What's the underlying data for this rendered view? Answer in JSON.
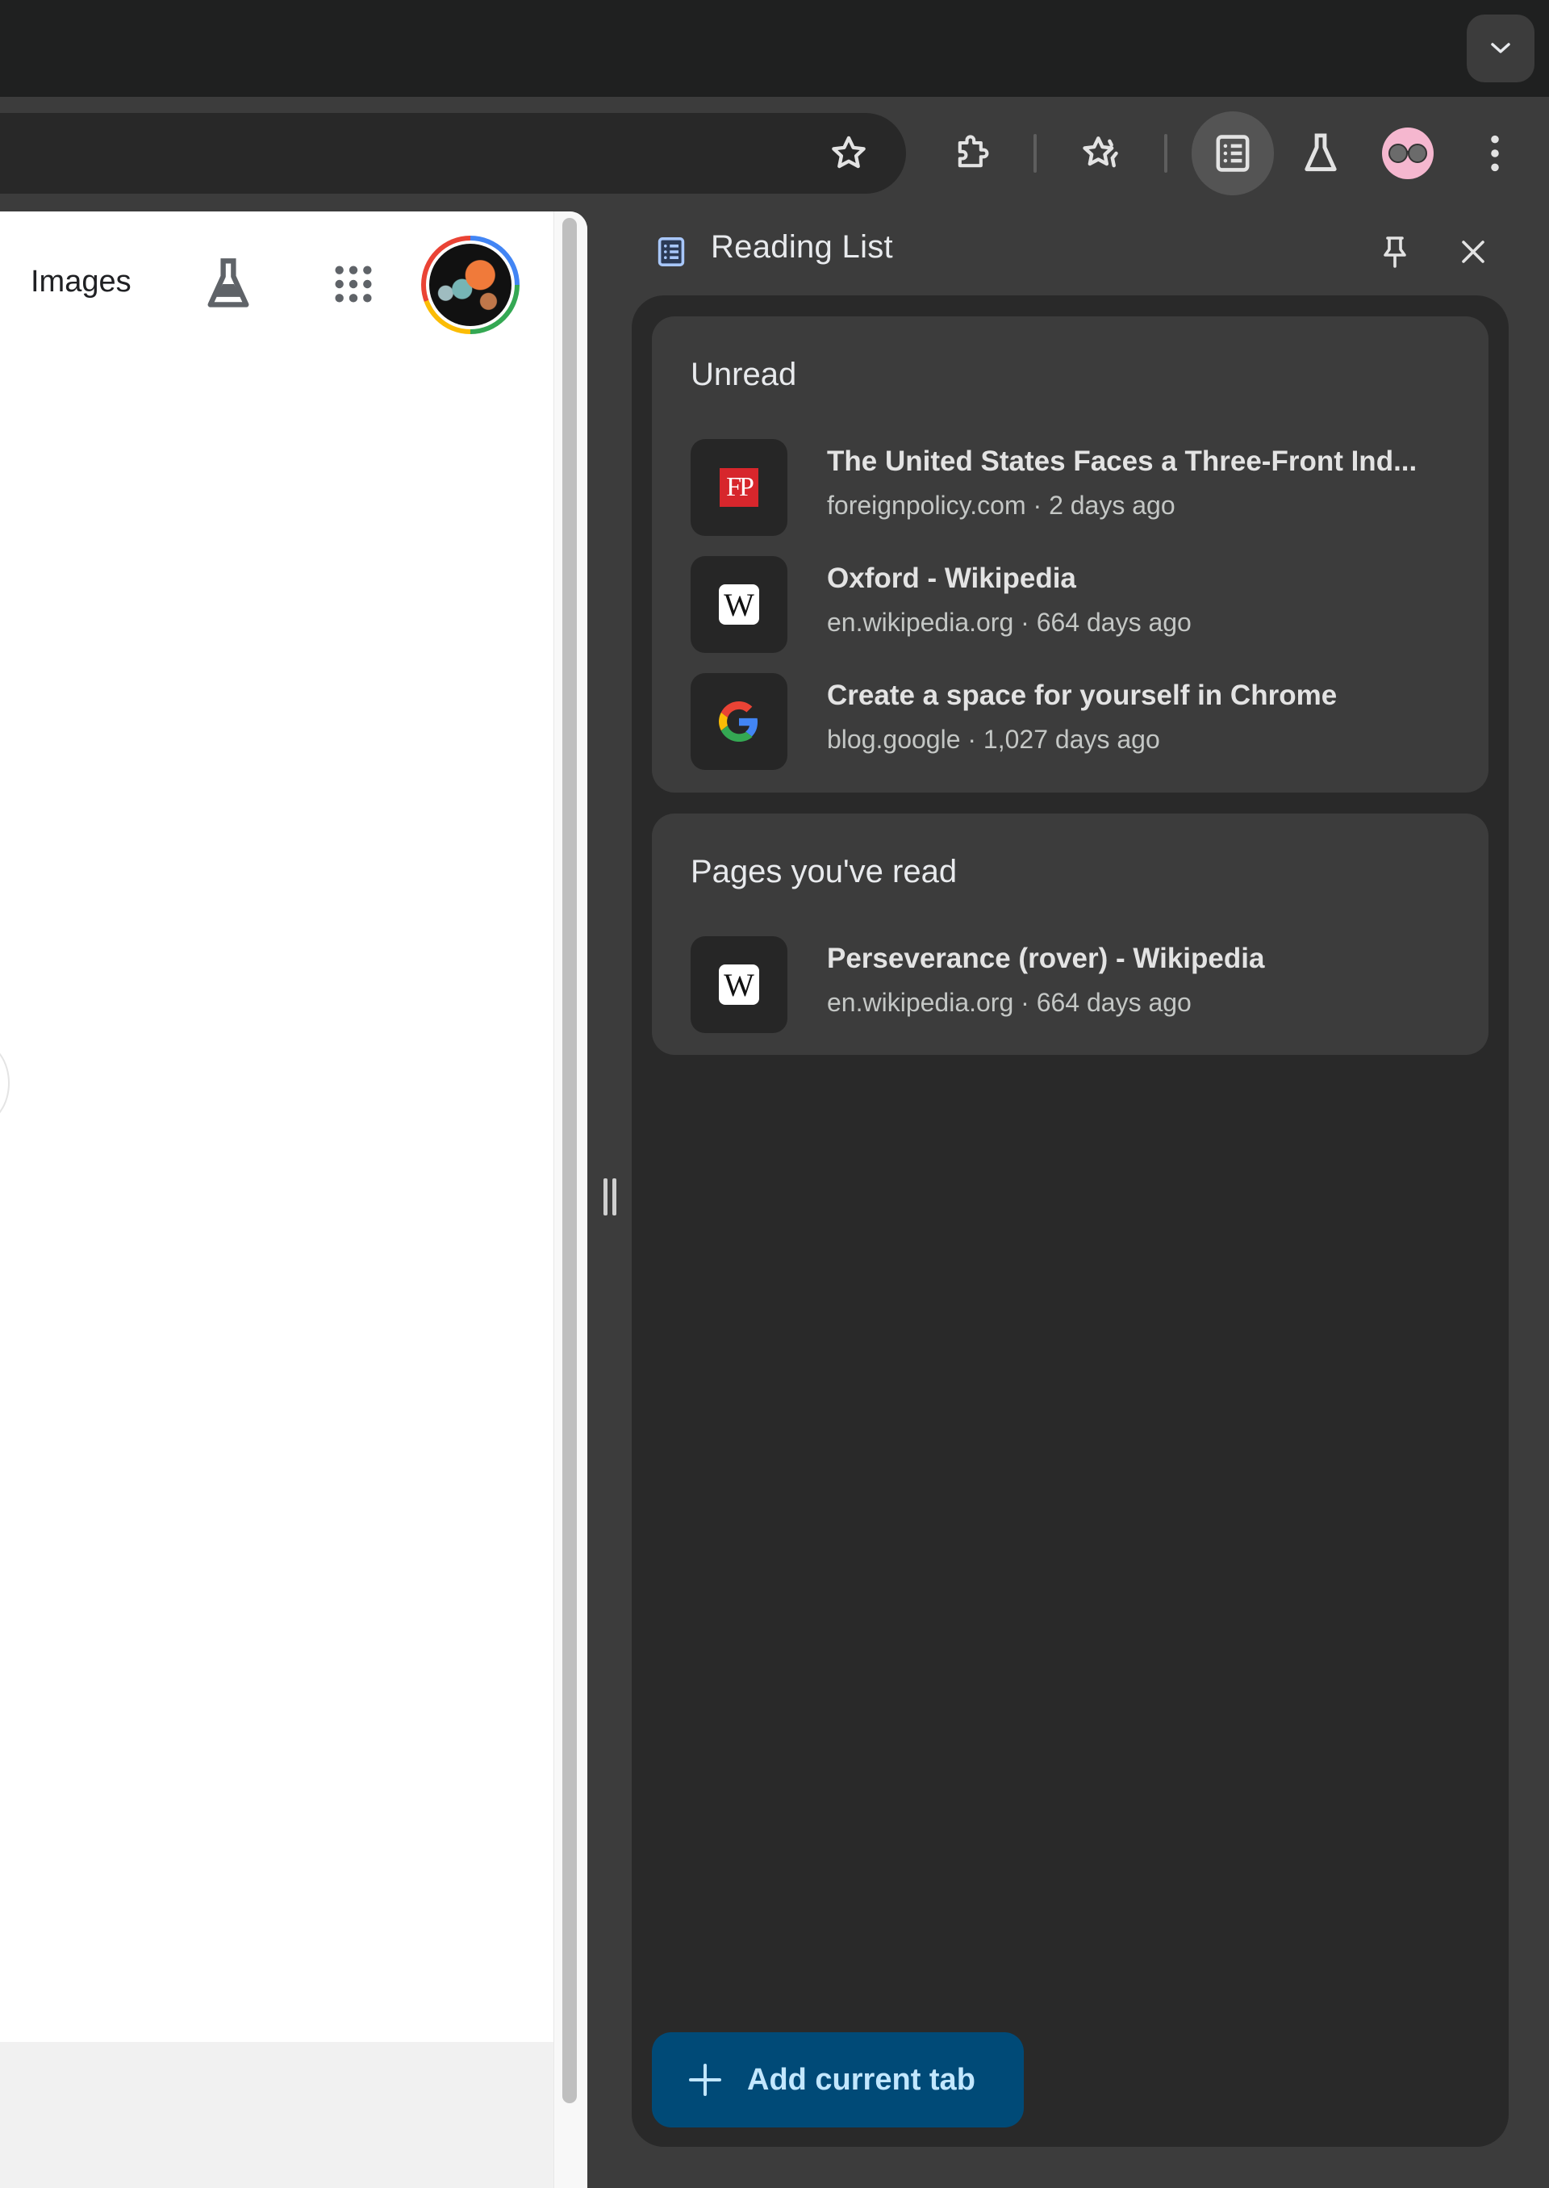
{
  "browser": {
    "toolbar": {
      "icons": [
        "bookmark-star-icon",
        "extensions-icon",
        "bookmarks-list-icon",
        "reading-list-icon",
        "labs-icon",
        "profile-avatar",
        "menu-icon"
      ],
      "tab_search_icon": "chevron-down-icon"
    }
  },
  "page": {
    "images_link": "Images",
    "icons": [
      "labs-flask-icon",
      "apps-grid-icon",
      "account-avatar"
    ]
  },
  "side_panel": {
    "title": "Reading List",
    "title_icon": "reading-list-icon",
    "pin_icon": "pin-icon",
    "close_icon": "close-icon",
    "accent_color": "#004a77",
    "sections": [
      {
        "title": "Unread",
        "items": [
          {
            "title": "The United States Faces a Three-Front Ind...",
            "domain": "foreignpolicy.com",
            "age": "2 days ago",
            "subtitle": "foreignpolicy.com · 2 days ago",
            "favicon": "FP",
            "favicon_color": "#d7262c"
          },
          {
            "title": "Oxford - Wikipedia",
            "domain": "en.wikipedia.org",
            "age": "664 days ago",
            "subtitle": "en.wikipedia.org · 664 days ago",
            "favicon": "W"
          },
          {
            "title": "Create a space for yourself in Chrome",
            "domain": "blog.google",
            "age": "1,027 days ago",
            "subtitle": "blog.google · 1,027 days ago",
            "favicon": "G"
          }
        ]
      },
      {
        "title": "Pages you've read",
        "items": [
          {
            "title": "Perseverance (rover) - Wikipedia",
            "domain": "en.wikipedia.org",
            "age": "664 days ago",
            "subtitle": "en.wikipedia.org · 664 days ago",
            "favicon": "W"
          }
        ]
      }
    ],
    "add_button_label": "Add current tab"
  }
}
